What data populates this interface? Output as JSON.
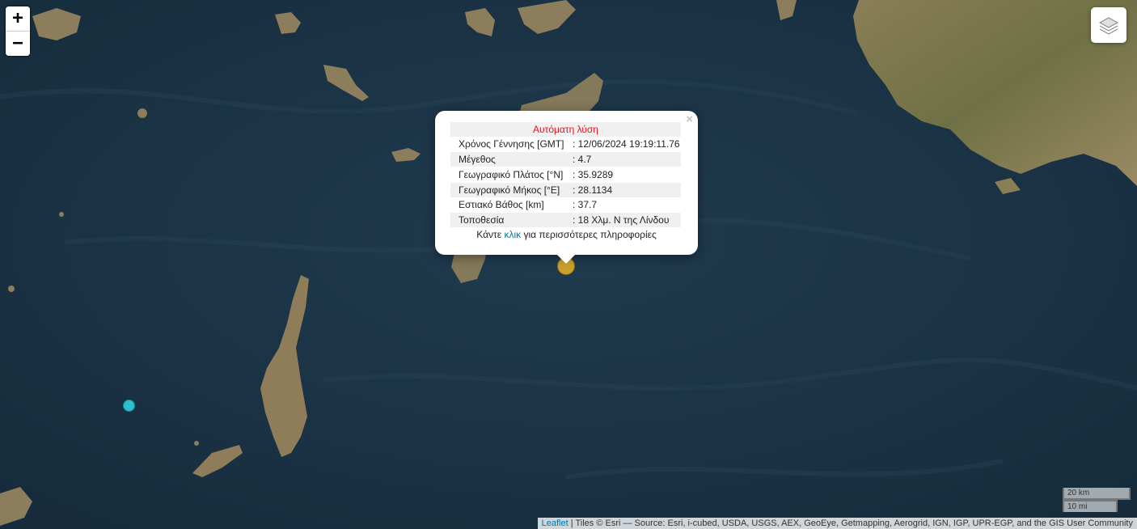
{
  "map": {
    "zoom_in_label": "+",
    "zoom_out_label": "−",
    "layers_icon": "layers-icon"
  },
  "popup": {
    "close_label": "×",
    "title": "Αυτόματη λύση",
    "rows": [
      {
        "label": "Χρόνος Γέννησης [GMT]",
        "value": ": 12/06/2024 19:19:11.76"
      },
      {
        "label": "Μέγεθος",
        "value": ": 4.7"
      },
      {
        "label": "Γεωγραφικό Πλάτος [°N]",
        "value": ": 35.9289"
      },
      {
        "label": "Γεωγραφικό Μήκος [°E]",
        "value": ": 28.1134"
      },
      {
        "label": "Εστιακό Βάθος [km]",
        "value": ": 37.7"
      },
      {
        "label": "Τοποθεσία",
        "value": ": 18 Χλμ. Ν της Λίνδου"
      }
    ],
    "footer_prefix": "Κάντε ",
    "footer_link": "κλικ",
    "footer_suffix": " για περισσότερες πληροφορίες"
  },
  "markers": {
    "selected_color": "#c9a02a",
    "other_color": "#2cc0cc"
  },
  "scale": {
    "km": "20 km",
    "mi": "10 mi"
  },
  "attribution": {
    "leaflet": "Leaflet",
    "text": " | Tiles © Esri — Source: Esri, i-cubed, USDA, USGS, AEX, GeoEye, Getmapping, Aerogrid, IGN, IGP, UPR-EGP, and the GIS User Community"
  }
}
